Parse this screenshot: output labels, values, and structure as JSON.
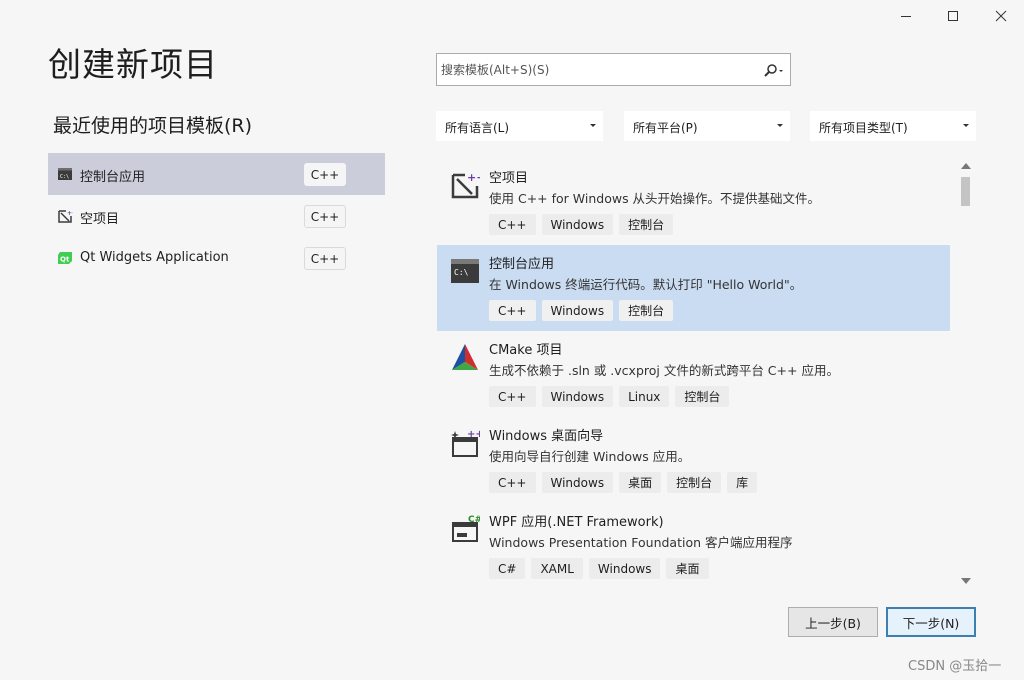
{
  "window_controls": {
    "minimize": "minimize-icon",
    "maximize": "maximize-icon",
    "close": "close-icon"
  },
  "page_title": "创建新项目",
  "recent": {
    "title": "最近使用的项目模板(R)",
    "items": [
      {
        "label": "控制台应用",
        "badge": "C++",
        "icon": "console-app-icon",
        "selected": true
      },
      {
        "label": "空项目",
        "badge": "C++",
        "icon": "empty-project-icon",
        "selected": false
      },
      {
        "label": "Qt Widgets Application",
        "badge": "C++",
        "icon": "qt-icon",
        "selected": false
      }
    ]
  },
  "search": {
    "placeholder": "搜索模板(Alt+S)(S)",
    "icon": "search-icon"
  },
  "filters": {
    "language": "所有语言(L)",
    "platform": "所有平台(P)",
    "project_type": "所有项目类型(T)"
  },
  "templates": [
    {
      "name": "空项目",
      "desc": "使用 C++ for Windows 从头开始操作。不提供基础文件。",
      "tags": [
        "C++",
        "Windows",
        "控制台"
      ],
      "icon": "empty-project-icon",
      "selected": false
    },
    {
      "name": "控制台应用",
      "desc": "在 Windows 终端运行代码。默认打印 \"Hello World\"。",
      "tags": [
        "C++",
        "Windows",
        "控制台"
      ],
      "icon": "console-app-icon",
      "selected": true
    },
    {
      "name": "CMake 项目",
      "desc": "生成不依赖于 .sln 或 .vcxproj 文件的新式跨平台 C++ 应用。",
      "tags": [
        "C++",
        "Windows",
        "Linux",
        "控制台"
      ],
      "icon": "cmake-icon",
      "selected": false
    },
    {
      "name": "Windows 桌面向导",
      "desc": "使用向导自行创建 Windows 应用。",
      "tags": [
        "C++",
        "Windows",
        "桌面",
        "控制台",
        "库"
      ],
      "icon": "desktop-wizard-icon",
      "selected": false
    },
    {
      "name": "WPF 应用(.NET Framework)",
      "desc": "Windows Presentation Foundation 客户端应用程序",
      "tags": [
        "C#",
        "XAML",
        "Windows",
        "桌面"
      ],
      "icon": "wpf-icon",
      "selected": false
    }
  ],
  "buttons": {
    "back": "上一步(B)",
    "next": "下一步(N)"
  },
  "watermark": "CSDN @玉拾一"
}
